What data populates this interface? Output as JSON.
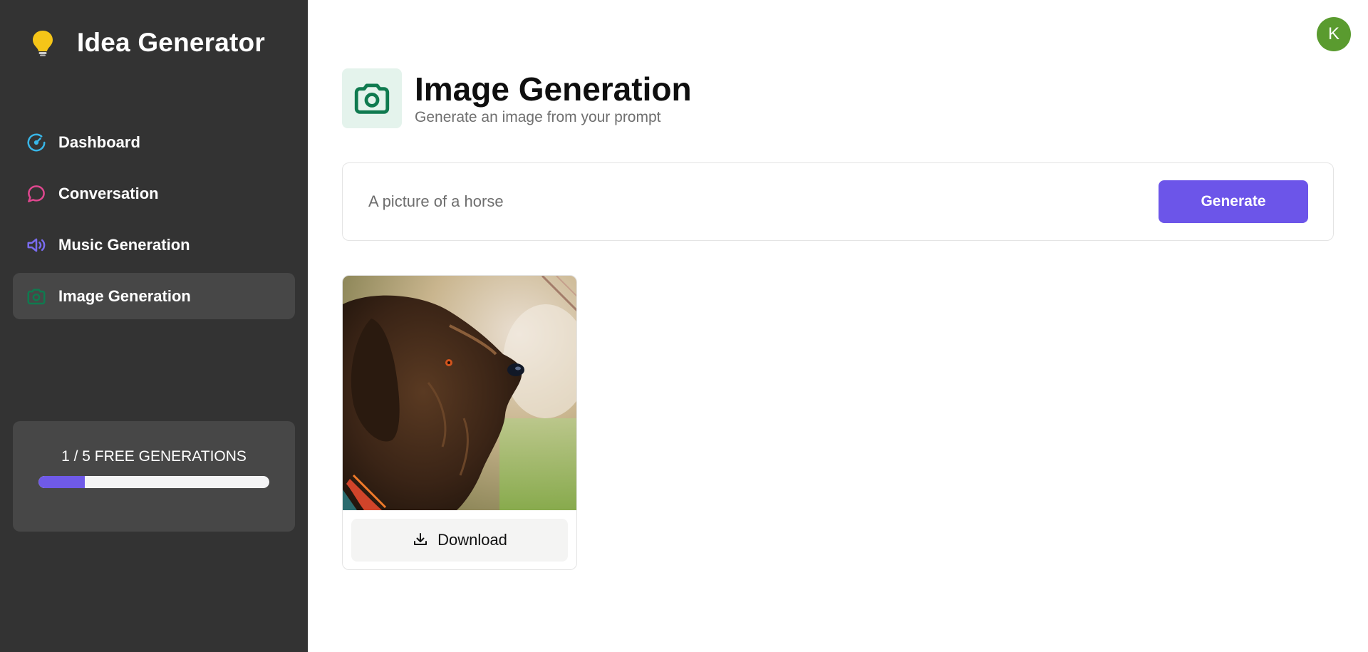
{
  "brand": {
    "title": "Idea Generator",
    "logo_icon": "lightbulb-icon",
    "logo_color": "#f5c518"
  },
  "sidebar": {
    "items": [
      {
        "label": "Dashboard",
        "icon": "gauge-icon",
        "color": "#38b6e8",
        "active": false
      },
      {
        "label": "Conversation",
        "icon": "chat-bubble-icon",
        "color": "#e0478f",
        "active": false
      },
      {
        "label": "Music Generation",
        "icon": "speaker-icon",
        "color": "#7a6cf0",
        "active": false
      },
      {
        "label": "Image Generation",
        "icon": "camera-icon",
        "color": "#0f7a4f",
        "active": true
      }
    ]
  },
  "credits": {
    "text": "1 / 5 FREE GENERATIONS",
    "used": 1,
    "limit": 5,
    "progress_fraction": 0.2,
    "fill_color": "#6f5ae8"
  },
  "user": {
    "avatar_initial": "K",
    "avatar_color": "#5a9b2f"
  },
  "header": {
    "title": "Image Generation",
    "subtitle": "Generate an image from your prompt",
    "icon": "camera-icon",
    "icon_color": "#0f7a4f",
    "icon_bg": "#e4f3ec"
  },
  "prompt": {
    "value": "",
    "placeholder": "A picture of a horse",
    "button_label": "Generate",
    "accent_color": "#6c55e9"
  },
  "results": [
    {
      "image_icon": "dog-photo",
      "download_label": "Download",
      "download_icon": "download-icon"
    }
  ]
}
